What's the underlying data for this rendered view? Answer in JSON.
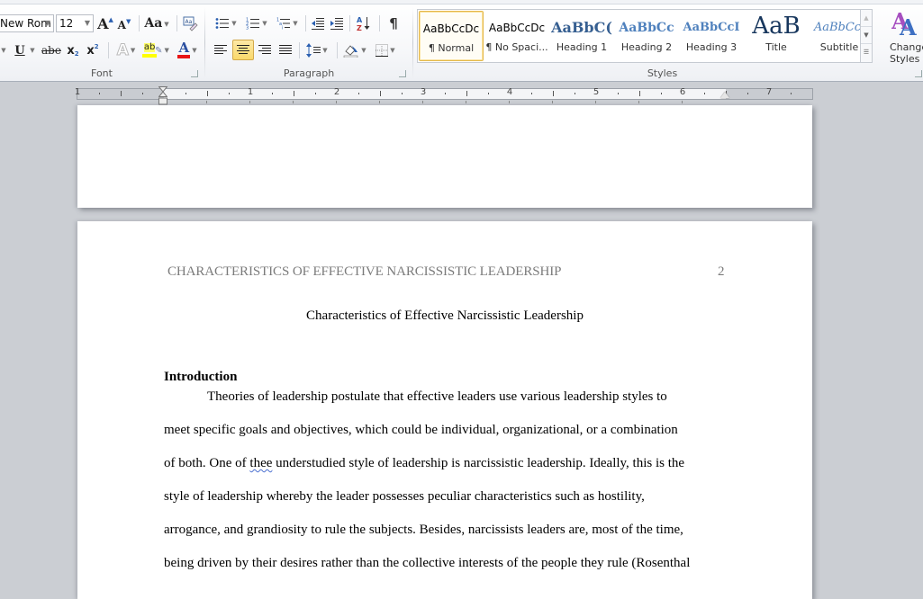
{
  "ribbon": {
    "font_group": {
      "label": "Font",
      "font_name": "New Rom",
      "font_size": "12",
      "grow_font": "A",
      "shrink_font": "A",
      "change_case": "Aa",
      "underline": "U",
      "strikethrough": "abe",
      "subscript": "x",
      "superscript": "x",
      "text_effects": "A",
      "highlight": "ab",
      "font_color": "A",
      "highlight_color": "#ffff00",
      "font_color_value": "#e81416"
    },
    "paragraph_group": {
      "label": "Paragraph",
      "sort": "A Z",
      "show_marks": "¶",
      "active_alignment": "center"
    },
    "styles_group": {
      "label": "Styles",
      "styles": [
        {
          "sample": "AaBbCcDc",
          "name": "¶ Normal",
          "selected": true
        },
        {
          "sample": "AaBbCcDc",
          "name": "¶ No Spaci...",
          "selected": false
        },
        {
          "sample": "AaBbC(",
          "name": "Heading 1",
          "selected": false
        },
        {
          "sample": "AaBbCc",
          "name": "Heading 2",
          "selected": false
        },
        {
          "sample": "AaBbCcI",
          "name": "Heading 3",
          "selected": false
        },
        {
          "sample": "AaB",
          "name": "Title",
          "selected": false
        },
        {
          "sample": "AaBbCc.",
          "name": "Subtitle",
          "selected": false
        }
      ],
      "change_styles_line1": "Change",
      "change_styles_line2": "Styles ▾"
    }
  },
  "ruler": {
    "numbers": [
      "1",
      "1",
      "2",
      "3",
      "4",
      "5",
      "6",
      "7"
    ]
  },
  "document": {
    "running_head": "CHARACTERISTICS OF EFFECTIVE NARCISSISTIC LEADERSHIP",
    "page_number": "2",
    "title": "Characteristics of Effective Narcissistic Leadership",
    "section_heading": "Introduction",
    "lines": [
      "Theories  of leadership postulate that effective leaders use various leadership styles to",
      "meet specific goals and objectives, which could be individual, organizational,  or a combination",
      "of both. One of ",
      "style of leadership whereby the leader possesses peculiar  characteristics  such as hostility,",
      "arrogance, and grandiosity to rule the subjects. Besides, narcissists leaders are, most of the time,",
      "being  driven by their desires rather than the collective interests of the people they rule  (Rosenthal"
    ],
    "misspelled_word": "thee",
    "line3_rest": " understudied style of leadership is narcissistic  leadership. Ideally, this is the"
  }
}
